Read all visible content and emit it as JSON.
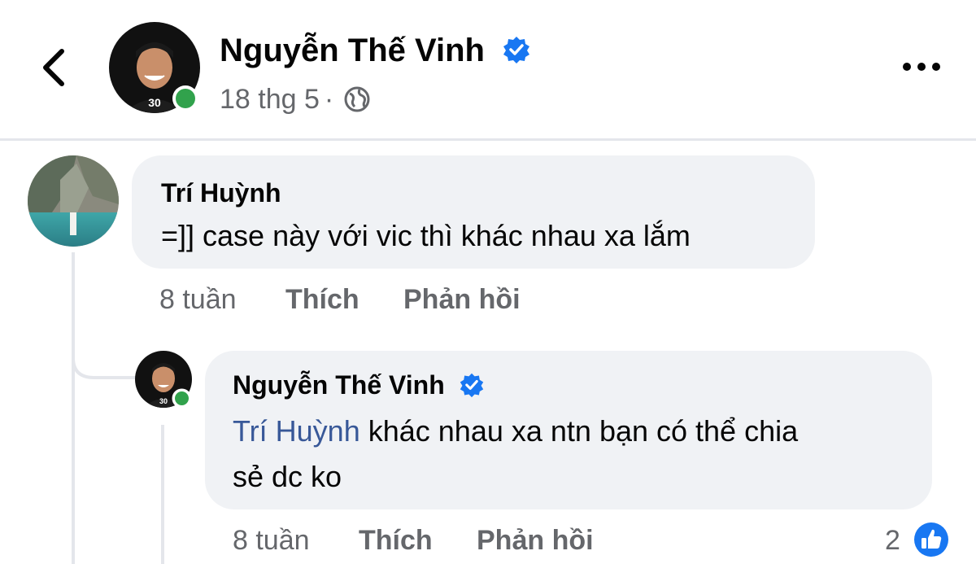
{
  "header": {
    "author_name": "Nguyễn Thế Vinh",
    "post_date": "18 thg 5",
    "separator": "·",
    "avatar_badge": "30",
    "icons": {
      "back": "chevron-left-icon",
      "verified": "verified-badge-icon",
      "privacy": "globe-icon",
      "more": "more-horizontal-icon"
    }
  },
  "comments": [
    {
      "author": "Trí Huỳnh",
      "text": "=]] case này với vic thì khác nhau xa lắm",
      "time": "8 tuần",
      "like_label": "Thích",
      "reply_label": "Phản hồi"
    },
    {
      "author": "Nguyễn Thế Vinh",
      "mention": "Trí Huỳnh",
      "text_line1": "khác nhau xa ntn bạn có thể chia",
      "text_line2": "sẻ dc ko",
      "time": "8 tuần",
      "like_label": "Thích",
      "reply_label": "Phản hồi",
      "reaction_count": "2",
      "avatar_badge": "30"
    }
  ],
  "colors": {
    "verified": "#1877f2",
    "online": "#31a24c",
    "mention": "#385898",
    "meta_text": "#65676b",
    "bubble": "#f0f2f5"
  }
}
